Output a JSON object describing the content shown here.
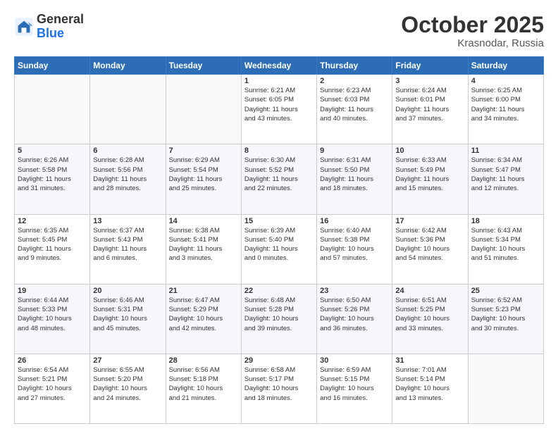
{
  "header": {
    "logo_general": "General",
    "logo_blue": "Blue",
    "month": "October 2025",
    "location": "Krasnodar, Russia"
  },
  "weekdays": [
    "Sunday",
    "Monday",
    "Tuesday",
    "Wednesday",
    "Thursday",
    "Friday",
    "Saturday"
  ],
  "weeks": [
    [
      {
        "day": "",
        "info": ""
      },
      {
        "day": "",
        "info": ""
      },
      {
        "day": "",
        "info": ""
      },
      {
        "day": "1",
        "info": "Sunrise: 6:21 AM\nSunset: 6:05 PM\nDaylight: 11 hours\nand 43 minutes."
      },
      {
        "day": "2",
        "info": "Sunrise: 6:23 AM\nSunset: 6:03 PM\nDaylight: 11 hours\nand 40 minutes."
      },
      {
        "day": "3",
        "info": "Sunrise: 6:24 AM\nSunset: 6:01 PM\nDaylight: 11 hours\nand 37 minutes."
      },
      {
        "day": "4",
        "info": "Sunrise: 6:25 AM\nSunset: 6:00 PM\nDaylight: 11 hours\nand 34 minutes."
      }
    ],
    [
      {
        "day": "5",
        "info": "Sunrise: 6:26 AM\nSunset: 5:58 PM\nDaylight: 11 hours\nand 31 minutes."
      },
      {
        "day": "6",
        "info": "Sunrise: 6:28 AM\nSunset: 5:56 PM\nDaylight: 11 hours\nand 28 minutes."
      },
      {
        "day": "7",
        "info": "Sunrise: 6:29 AM\nSunset: 5:54 PM\nDaylight: 11 hours\nand 25 minutes."
      },
      {
        "day": "8",
        "info": "Sunrise: 6:30 AM\nSunset: 5:52 PM\nDaylight: 11 hours\nand 22 minutes."
      },
      {
        "day": "9",
        "info": "Sunrise: 6:31 AM\nSunset: 5:50 PM\nDaylight: 11 hours\nand 18 minutes."
      },
      {
        "day": "10",
        "info": "Sunrise: 6:33 AM\nSunset: 5:49 PM\nDaylight: 11 hours\nand 15 minutes."
      },
      {
        "day": "11",
        "info": "Sunrise: 6:34 AM\nSunset: 5:47 PM\nDaylight: 11 hours\nand 12 minutes."
      }
    ],
    [
      {
        "day": "12",
        "info": "Sunrise: 6:35 AM\nSunset: 5:45 PM\nDaylight: 11 hours\nand 9 minutes."
      },
      {
        "day": "13",
        "info": "Sunrise: 6:37 AM\nSunset: 5:43 PM\nDaylight: 11 hours\nand 6 minutes."
      },
      {
        "day": "14",
        "info": "Sunrise: 6:38 AM\nSunset: 5:41 PM\nDaylight: 11 hours\nand 3 minutes."
      },
      {
        "day": "15",
        "info": "Sunrise: 6:39 AM\nSunset: 5:40 PM\nDaylight: 11 hours\nand 0 minutes."
      },
      {
        "day": "16",
        "info": "Sunrise: 6:40 AM\nSunset: 5:38 PM\nDaylight: 10 hours\nand 57 minutes."
      },
      {
        "day": "17",
        "info": "Sunrise: 6:42 AM\nSunset: 5:36 PM\nDaylight: 10 hours\nand 54 minutes."
      },
      {
        "day": "18",
        "info": "Sunrise: 6:43 AM\nSunset: 5:34 PM\nDaylight: 10 hours\nand 51 minutes."
      }
    ],
    [
      {
        "day": "19",
        "info": "Sunrise: 6:44 AM\nSunset: 5:33 PM\nDaylight: 10 hours\nand 48 minutes."
      },
      {
        "day": "20",
        "info": "Sunrise: 6:46 AM\nSunset: 5:31 PM\nDaylight: 10 hours\nand 45 minutes."
      },
      {
        "day": "21",
        "info": "Sunrise: 6:47 AM\nSunset: 5:29 PM\nDaylight: 10 hours\nand 42 minutes."
      },
      {
        "day": "22",
        "info": "Sunrise: 6:48 AM\nSunset: 5:28 PM\nDaylight: 10 hours\nand 39 minutes."
      },
      {
        "day": "23",
        "info": "Sunrise: 6:50 AM\nSunset: 5:26 PM\nDaylight: 10 hours\nand 36 minutes."
      },
      {
        "day": "24",
        "info": "Sunrise: 6:51 AM\nSunset: 5:25 PM\nDaylight: 10 hours\nand 33 minutes."
      },
      {
        "day": "25",
        "info": "Sunrise: 6:52 AM\nSunset: 5:23 PM\nDaylight: 10 hours\nand 30 minutes."
      }
    ],
    [
      {
        "day": "26",
        "info": "Sunrise: 6:54 AM\nSunset: 5:21 PM\nDaylight: 10 hours\nand 27 minutes."
      },
      {
        "day": "27",
        "info": "Sunrise: 6:55 AM\nSunset: 5:20 PM\nDaylight: 10 hours\nand 24 minutes."
      },
      {
        "day": "28",
        "info": "Sunrise: 6:56 AM\nSunset: 5:18 PM\nDaylight: 10 hours\nand 21 minutes."
      },
      {
        "day": "29",
        "info": "Sunrise: 6:58 AM\nSunset: 5:17 PM\nDaylight: 10 hours\nand 18 minutes."
      },
      {
        "day": "30",
        "info": "Sunrise: 6:59 AM\nSunset: 5:15 PM\nDaylight: 10 hours\nand 16 minutes."
      },
      {
        "day": "31",
        "info": "Sunrise: 7:01 AM\nSunset: 5:14 PM\nDaylight: 10 hours\nand 13 minutes."
      },
      {
        "day": "",
        "info": ""
      }
    ]
  ]
}
